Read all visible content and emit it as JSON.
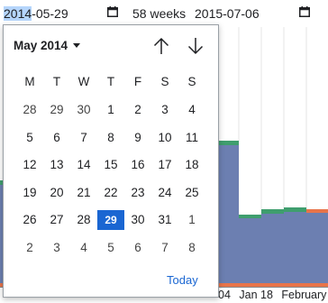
{
  "filter": {
    "start_year_selected": "2014",
    "start_rest": "-05-29",
    "duration": "58 weeks",
    "end_date": "2015-07-06"
  },
  "picker": {
    "month_label": "May 2014",
    "weekdays": [
      "M",
      "T",
      "W",
      "T",
      "F",
      "S",
      "S"
    ],
    "weeks": [
      [
        "28",
        "29",
        "30",
        "1",
        "2",
        "3",
        "4"
      ],
      [
        "5",
        "6",
        "7",
        "8",
        "9",
        "10",
        "11"
      ],
      [
        "12",
        "13",
        "14",
        "15",
        "16",
        "17",
        "18"
      ],
      [
        "19",
        "20",
        "21",
        "22",
        "23",
        "24",
        "25"
      ],
      [
        "26",
        "27",
        "28",
        "29",
        "30",
        "31",
        "1"
      ],
      [
        "2",
        "3",
        "4",
        "5",
        "6",
        "7",
        "8"
      ]
    ],
    "selected_day": "29",
    "today_label": "Today"
  },
  "chart_labels": {
    "x_ticks": [
      "04",
      "Jan 18",
      "February"
    ]
  },
  "colors": {
    "bar": "#6c7fb1",
    "bar_top_green": "#3f9e6e",
    "bar_orange": "#e8744a",
    "selected": "#1a66d2",
    "year_highlight": "#b5d5fb"
  }
}
